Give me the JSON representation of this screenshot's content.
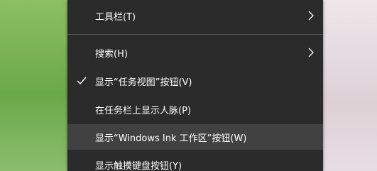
{
  "context_menu": {
    "items": [
      {
        "label": "工具栏(T)",
        "checked": false,
        "submenu": true,
        "highlighted": false
      },
      {
        "label": "搜索(H)",
        "checked": false,
        "submenu": true,
        "highlighted": false
      },
      {
        "label": "显示“任务视图”按钮(V)",
        "checked": true,
        "submenu": false,
        "highlighted": false
      },
      {
        "label": "在任务栏上显示人脉(P)",
        "checked": false,
        "submenu": false,
        "highlighted": false
      },
      {
        "label": "显示“Windows Ink 工作区”按钮(W)",
        "checked": false,
        "submenu": false,
        "highlighted": true
      },
      {
        "label": "显示触摸键盘按钮(Y)",
        "checked": false,
        "submenu": false,
        "highlighted": false
      }
    ],
    "icons": {
      "check": "checkmark-icon",
      "submenu": "chevron-right-icon"
    },
    "colors": {
      "background": "#2b2b2b",
      "highlight": "#414141",
      "text": "#ffffff",
      "separator": "#555555"
    }
  }
}
